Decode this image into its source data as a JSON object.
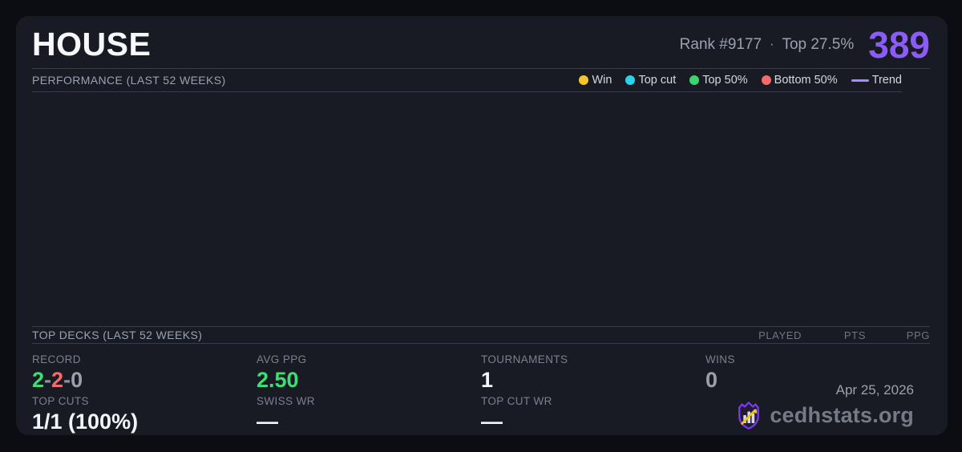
{
  "card": {
    "title": "HOUSE",
    "rank_text": "Rank #9177",
    "rank_separator": "·",
    "top_percent": "Top 27.5%",
    "score": "389",
    "accent_color": "#8b5cf6"
  },
  "performance": {
    "header": "PERFORMANCE (LAST 52 WEEKS)",
    "legend": [
      {
        "label": "Win",
        "color": "#f7c32b",
        "marker": "dot"
      },
      {
        "label": "Top cut",
        "color": "#2bd3ea",
        "marker": "dot"
      },
      {
        "label": "Top 50%",
        "color": "#3bd46f",
        "marker": "dot"
      },
      {
        "label": "Bottom 50%",
        "color": "#f56b6b",
        "marker": "dot"
      },
      {
        "label": "Trend",
        "color": "#a78bfa",
        "marker": "line"
      }
    ],
    "chart": {
      "type": "scatter",
      "points": [],
      "note": "chart area is empty — no data points plotted"
    }
  },
  "top_decks": {
    "header": "TOP DECKS (LAST 52 WEEKS)",
    "columns": [
      "PLAYED",
      "PTS",
      "PPG"
    ],
    "rows": []
  },
  "stats": {
    "record": {
      "label": "RECORD",
      "wins": "2",
      "losses": "2",
      "draws": "0",
      "sep": "-",
      "colors": {
        "wins": "#3edd76",
        "losses": "#f56b6b",
        "draws": "#9aa0ab"
      }
    },
    "avg_ppg": {
      "label": "AVG PPG",
      "value": "2.50",
      "color": "#3edd76"
    },
    "tournaments": {
      "label": "TOURNAMENTS",
      "value": "1"
    },
    "wins": {
      "label": "WINS",
      "value": "0",
      "color": "#9aa0ab"
    },
    "top_cuts": {
      "label": "TOP CUTS",
      "value": "1/1 (100%)"
    },
    "swiss_wr": {
      "label": "SWISS WR",
      "value": "—"
    },
    "top_cut_wr": {
      "label": "TOP CUT WR",
      "value": "—"
    }
  },
  "footer": {
    "date": "Apr 25, 2026",
    "brand": "cedhstats.org"
  }
}
